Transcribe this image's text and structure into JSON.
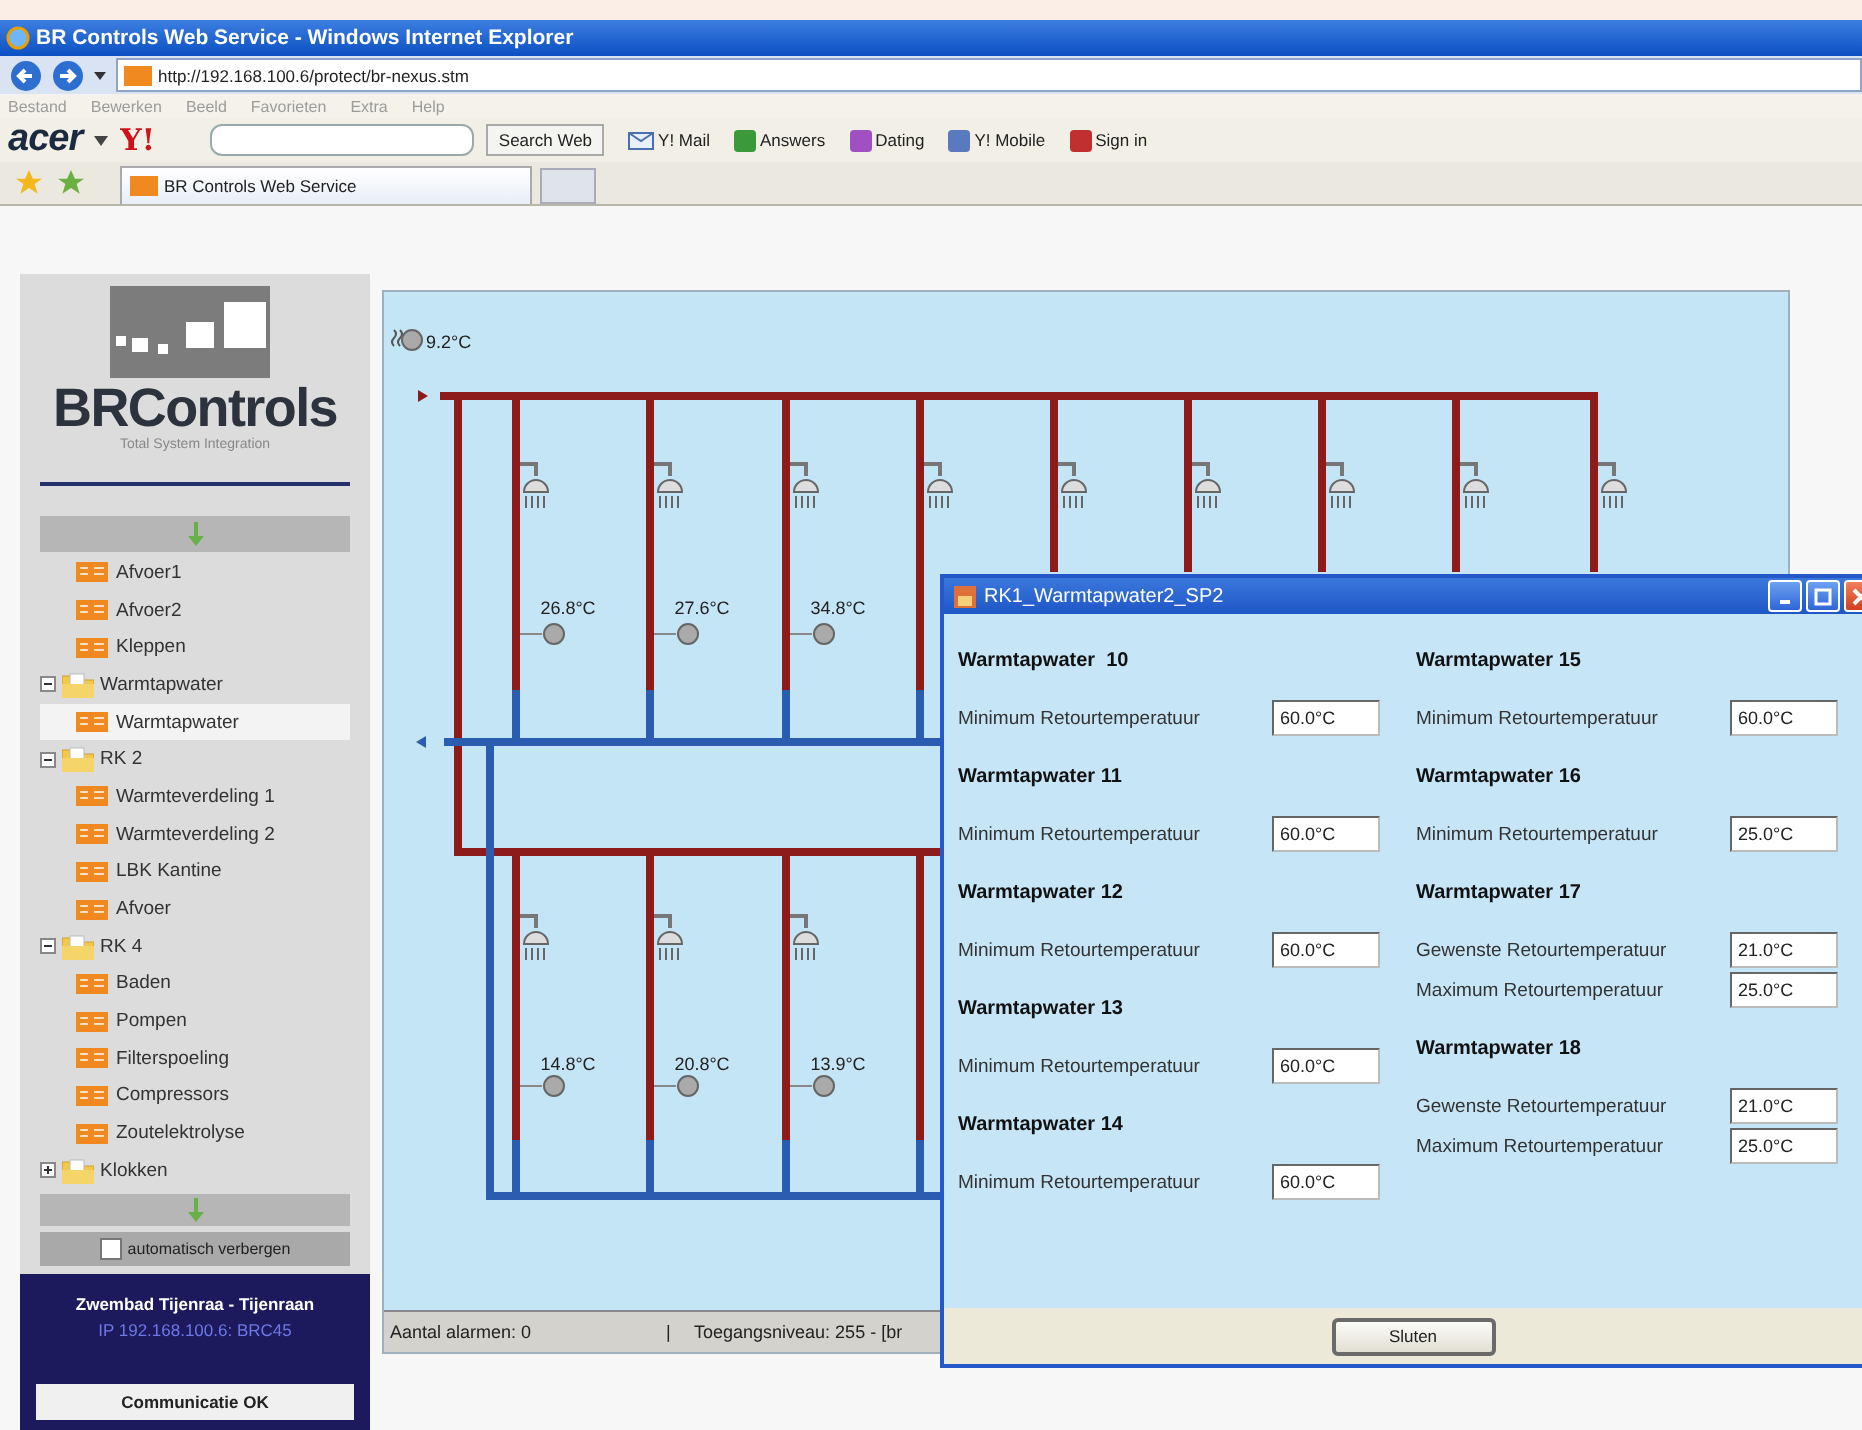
{
  "browser": {
    "title": "BR Controls Web Service - Windows Internet Explorer",
    "address": "http://192.168.100.6/protect/br-nexus.stm",
    "menu": [
      "Bestand",
      "Bewerken",
      "Beeld",
      "Favorieten",
      "Extra",
      "Help"
    ],
    "toolbar": {
      "brand": "acer",
      "yahoo": "Y!",
      "search_button": "Search Web",
      "links": [
        "Y! Mail",
        "Answers",
        "Dating",
        "Y! Mobile",
        "Sign in"
      ]
    },
    "tabs": [
      {
        "label": "BR Controls Web Service",
        "selected": true
      }
    ]
  },
  "sidebar": {
    "logo": "BRControls",
    "tagline": "Total System Integration",
    "tree": [
      {
        "label": "Afvoer1",
        "kind": "page",
        "selected": false
      },
      {
        "label": "Afvoer2",
        "kind": "page",
        "selected": false
      },
      {
        "label": "Kleppen",
        "kind": "page",
        "selected": false
      },
      {
        "label": "Warmtapwater",
        "kind": "folder",
        "expanded": true,
        "children": [
          {
            "label": "Warmtapwater",
            "kind": "page",
            "selected": true
          }
        ]
      },
      {
        "label": "RK 2",
        "kind": "folder",
        "expanded": true,
        "children": [
          {
            "label": "Warmteverdeling 1",
            "kind": "page",
            "selected": false
          },
          {
            "label": "Warmteverdeling 2",
            "kind": "page",
            "selected": false
          },
          {
            "label": "LBK Kantine",
            "kind": "page",
            "selected": false
          },
          {
            "label": "Afvoer",
            "kind": "page",
            "selected": false
          }
        ]
      },
      {
        "label": "RK 4",
        "kind": "folder",
        "expanded": true,
        "children": [
          {
            "label": "Baden",
            "kind": "page",
            "selected": false
          },
          {
            "label": "Pompen",
            "kind": "page",
            "selected": false
          },
          {
            "label": "Filterspoeling",
            "kind": "page",
            "selected": false
          },
          {
            "label": "Compressors",
            "kind": "page",
            "selected": false
          },
          {
            "label": "Zoutelektrolyse",
            "kind": "page",
            "selected": false
          }
        ]
      },
      {
        "label": "Klokken",
        "kind": "folder",
        "expanded": false
      }
    ],
    "auto_hide": {
      "label": "automatisch verbergen",
      "checked": false
    },
    "site": "Zwembad Tijenraa - Tijenraan",
    "ip": "IP 192.168.100.6: BRC45",
    "status": "Communicatie OK"
  },
  "diagram": {
    "supply_temp": "9.2°C",
    "upper_temps": [
      "26.8°C",
      "27.6°C",
      "34.8°C"
    ],
    "lower_temps": [
      "14.8°C",
      "20.8°C",
      "13.9°C"
    ],
    "status_bar": [
      "Aantal alarmen: 0",
      "|",
      "Toegangsniveau: 255 - [br"
    ]
  },
  "dialog": {
    "title": "RK1_Warmtapwater2_SP2",
    "columns": [
      [
        {
          "title": "Warmtapwater  10",
          "rows": [
            {
              "label": "Minimum Retourtemperatuur",
              "value": "60.0°C"
            }
          ]
        },
        {
          "title": "Warmtapwater 11",
          "rows": [
            {
              "label": "Minimum Retourtemperatuur",
              "value": "60.0°C"
            }
          ]
        },
        {
          "title": "Warmtapwater 12",
          "rows": [
            {
              "label": "Minimum Retourtemperatuur",
              "value": "60.0°C"
            }
          ]
        },
        {
          "title": "Warmtapwater 13",
          "rows": [
            {
              "label": "Minimum Retourtemperatuur",
              "value": "60.0°C"
            }
          ]
        },
        {
          "title": "Warmtapwater 14",
          "rows": [
            {
              "label": "Minimum Retourtemperatuur",
              "value": "60.0°C"
            }
          ]
        }
      ],
      [
        {
          "title": "Warmtapwater 15",
          "rows": [
            {
              "label": "Minimum Retourtemperatuur",
              "value": "60.0°C"
            }
          ]
        },
        {
          "title": "Warmtapwater 16",
          "rows": [
            {
              "label": "Minimum Retourtemperatuur",
              "value": "25.0°C"
            }
          ]
        },
        {
          "title": "Warmtapwater 17",
          "rows": [
            {
              "label": "Gewenste Retourtemperatuur",
              "value": "21.0°C"
            },
            {
              "label": "Maximum Retourtemperatuur",
              "value": "25.0°C"
            }
          ]
        },
        {
          "title": "Warmtapwater 18",
          "rows": [
            {
              "label": "Gewenste Retourtemperatuur",
              "value": "21.0°C"
            },
            {
              "label": "Maximum Retourtemperatuur",
              "value": "25.0°C"
            }
          ]
        }
      ]
    ],
    "button": "Sluten"
  }
}
